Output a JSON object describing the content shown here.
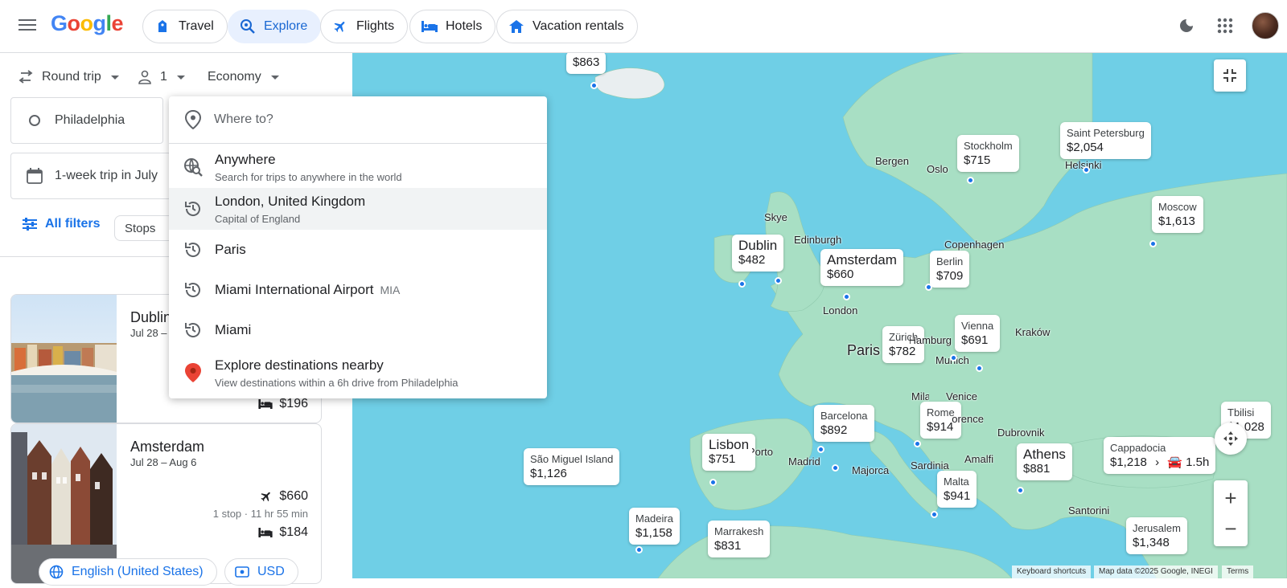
{
  "header": {
    "logo": "Google",
    "tabs": [
      {
        "label": "Travel",
        "icon": "travel-tag-icon"
      },
      {
        "label": "Explore",
        "icon": "explore-icon"
      },
      {
        "label": "Flights",
        "icon": "flight-icon"
      },
      {
        "label": "Hotels",
        "icon": "bed-icon"
      },
      {
        "label": "Vacation rentals",
        "icon": "home-icon"
      }
    ]
  },
  "search": {
    "trip_type": "Round trip",
    "passengers": "1",
    "cabin_class": "Economy",
    "origin": "Philadelphia",
    "dates": "1-week trip in July",
    "destination_placeholder": "Where to?"
  },
  "filters": {
    "all_filters": "All filters",
    "stops": "Stops"
  },
  "dropdown": {
    "items": [
      {
        "title": "Anywhere",
        "subtitle": "Search for trips to anywhere in the world",
        "icon": "globe-search-icon"
      },
      {
        "title": "London, United Kingdom",
        "subtitle": "Capital of England",
        "icon": "history-icon"
      },
      {
        "title": "Paris",
        "subtitle": "",
        "icon": "history-icon"
      },
      {
        "title": "Miami International Airport",
        "code": "MIA",
        "icon": "history-icon"
      },
      {
        "title": "Miami",
        "subtitle": "",
        "icon": "history-icon"
      },
      {
        "title": "Explore destinations nearby",
        "subtitle": "View destinations within a 6h drive from Philadelphia",
        "icon": "location-pin-icon"
      }
    ]
  },
  "results": [
    {
      "city": "Dublin",
      "dates": "Jul 28 – ",
      "hotel_price": "$196"
    },
    {
      "city": "Amsterdam",
      "dates": "Jul 28 – Aug 6",
      "flight_price": "$660",
      "stops": "1 stop · 11 hr 55 min",
      "hotel_price": "$184"
    }
  ],
  "footer": {
    "language": "English (United States)",
    "currency": "USD"
  },
  "map": {
    "prices": [
      {
        "name": "",
        "price": "$863"
      },
      {
        "name": "Stockholm",
        "price": "$715"
      },
      {
        "name": "Saint Petersburg",
        "price": "$2,054"
      },
      {
        "name": "Moscow",
        "price": "$1,613"
      },
      {
        "name": "Dublin",
        "price": "$482"
      },
      {
        "name": "Amsterdam",
        "price": "$660"
      },
      {
        "name": "Berlin",
        "price": "$709"
      },
      {
        "name": "Vienna",
        "price": "$691"
      },
      {
        "name": "Zürich",
        "price": "$782"
      },
      {
        "name": "Barcelona",
        "price": "$892"
      },
      {
        "name": "Rome",
        "price": "$914"
      },
      {
        "name": "Lisbon",
        "price": "$751"
      },
      {
        "name": "São Miguel Island",
        "price": "$1,126"
      },
      {
        "name": "Athens",
        "price": "$881"
      },
      {
        "name": "Cappadocia",
        "price": "$1,218",
        "drive": "1.5h"
      },
      {
        "name": "Tbilisi",
        "price": "$1,028"
      },
      {
        "name": "Malta",
        "price": "$941"
      },
      {
        "name": "Madeira",
        "price": "$1,158"
      },
      {
        "name": "Marrakesh",
        "price": "$831"
      },
      {
        "name": "Jerusalem",
        "price": "$1,348"
      }
    ],
    "labels": [
      "Bergen",
      "Oslo",
      "Helsinki",
      "Skye",
      "Edinburgh",
      "Copenhagen",
      "London",
      "Paris",
      "Hamburg",
      "Munich",
      "Kraków",
      "Milan",
      "Venice",
      "Florence",
      "Dubrovnik",
      "Porto",
      "Madrid",
      "Majorca",
      "Sardinia",
      "Amalfi",
      "Santorini"
    ],
    "attribution": {
      "shortcuts": "Keyboard shortcuts",
      "data": "Map data ©2025 Google, INEGI",
      "terms": "Terms"
    }
  },
  "colors": {
    "accent": "#1a73e8",
    "water": "#6fcfe6",
    "land": "#a8dfc4"
  }
}
